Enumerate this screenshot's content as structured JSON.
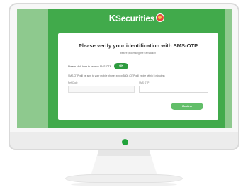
{
  "brand": {
    "k": "K",
    "name": "Securities"
  },
  "dialog": {
    "title": "Please verify your identification with SMS-OTP",
    "subtitle": "before processing the transaction",
    "request_prompt": "Please click here to receive SMS-OTP",
    "ok_label": "OK",
    "sent_note": "SMS-OTP will be sent to your mobile phone: xxxxxx5808 (OTP will expire within 5 minutes)",
    "ref_code_label": "Ref Code",
    "sms_otp_label": "SMS OTP",
    "confirm_label": "Confirm"
  },
  "colors": {
    "screen_green": "#41aa4b",
    "button_green": "#2e9b3f",
    "confirm_green": "#62be69",
    "power_led": "#20a33a"
  }
}
